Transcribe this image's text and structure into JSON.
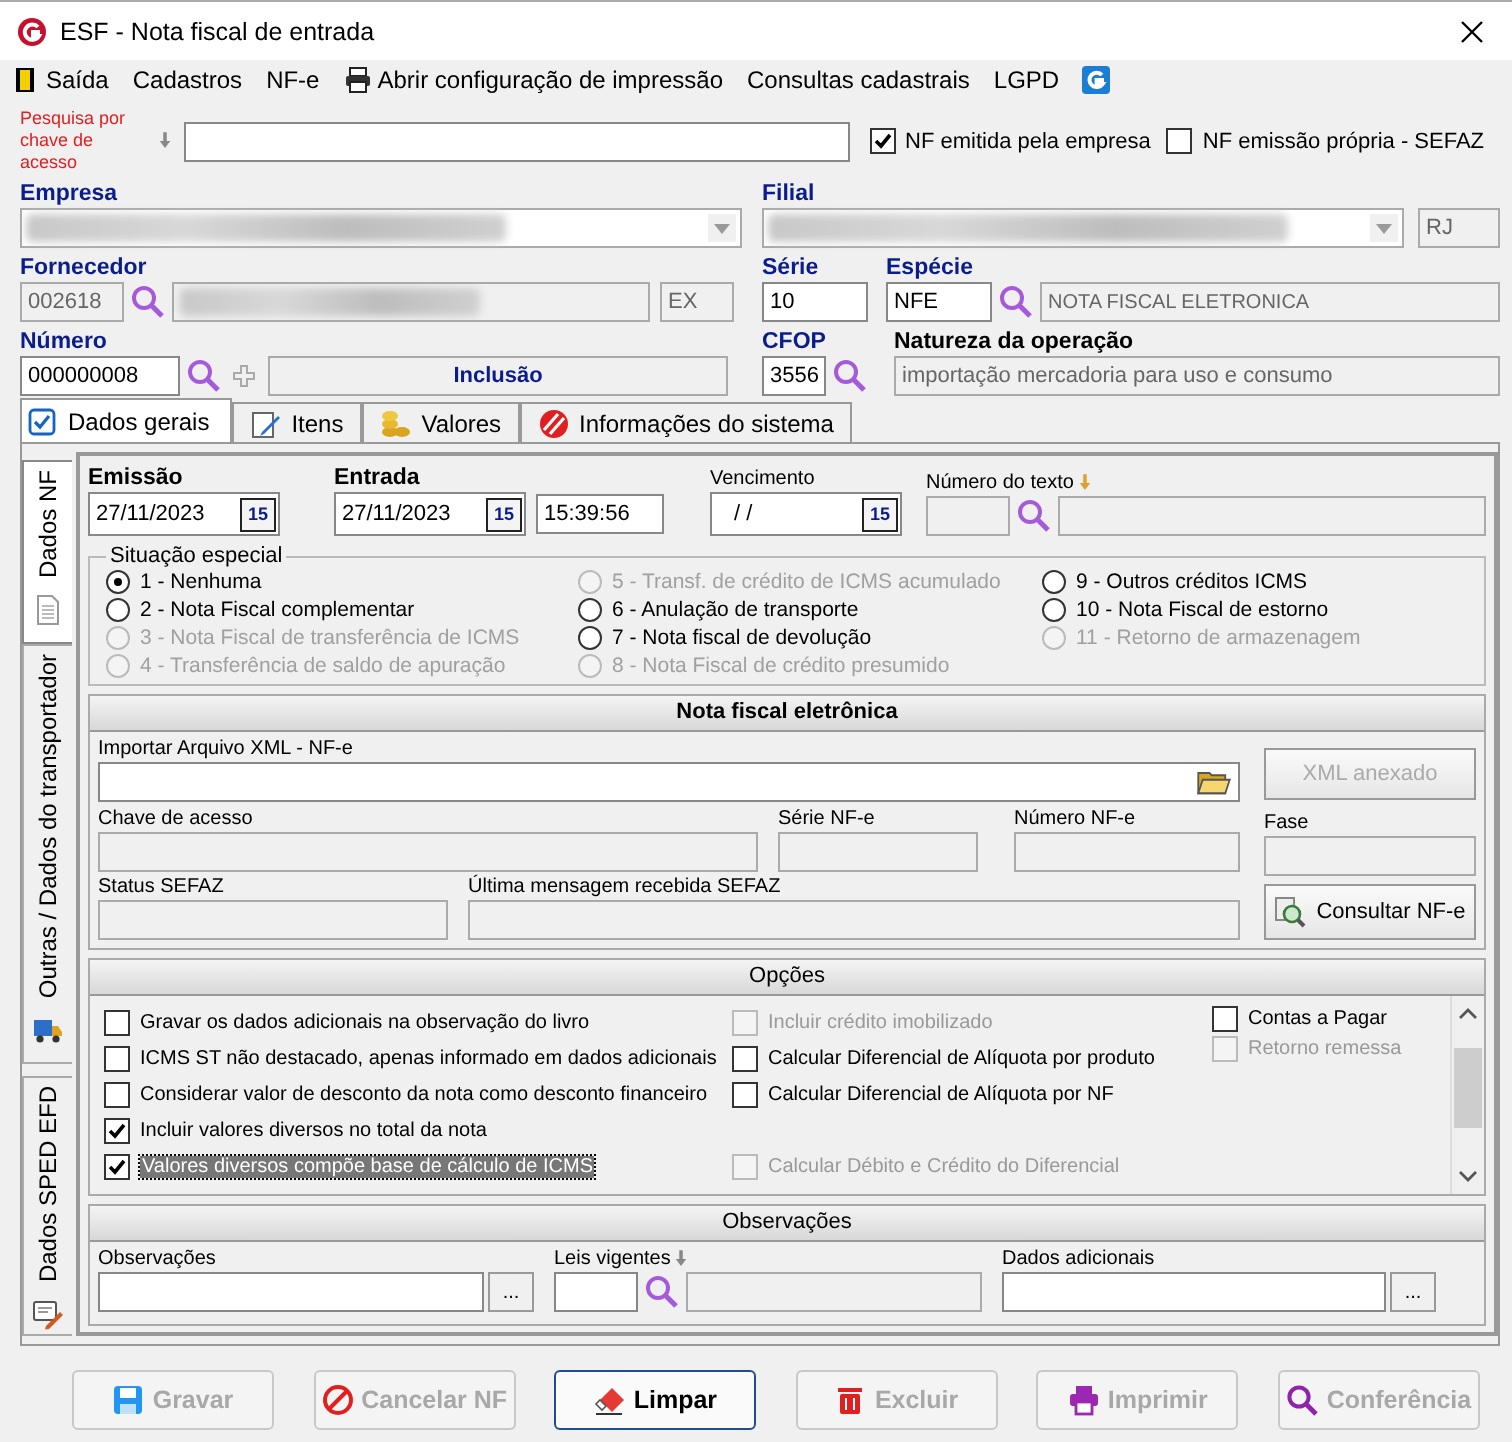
{
  "window": {
    "title": "ESF - Nota fiscal de entrada"
  },
  "menu": [
    {
      "label": "Saída"
    },
    {
      "label": "Cadastros"
    },
    {
      "label": "NF-e"
    },
    {
      "label": "Abrir configuração de impressão"
    },
    {
      "label": "Consultas cadastrais"
    },
    {
      "label": "LGPD"
    }
  ],
  "search": {
    "label": "Pesquisa por chave de acesso"
  },
  "flags": [
    {
      "label": "NF emitida pela empresa",
      "checked": true
    },
    {
      "label": "NF emissão própria - SEFAZ",
      "checked": false
    }
  ],
  "empresa": {
    "label": "Empresa"
  },
  "filial": {
    "label": "Filial",
    "uf": "RJ"
  },
  "fornecedor": {
    "label": "Fornecedor",
    "code": "002618",
    "uf": "EX"
  },
  "serie": {
    "label": "Série",
    "value": "10"
  },
  "especie": {
    "label": "Espécie",
    "code": "NFE",
    "name": "NOTA FISCAL ELETRONICA"
  },
  "numero": {
    "label": "Número",
    "value": "000000008",
    "mode": "Inclusão"
  },
  "cfop": {
    "label": "CFOP",
    "value": "3556"
  },
  "natureza": {
    "label": "Natureza da operação",
    "value": "importação mercadoria para uso e consumo"
  },
  "tabs": [
    {
      "label": "Dados gerais",
      "selected": true
    },
    {
      "label": "Itens",
      "selected": false
    },
    {
      "label": "Valores",
      "selected": false
    },
    {
      "label": "Informações do sistema",
      "selected": false
    }
  ],
  "side_tabs": [
    {
      "label": "Dados NF",
      "selected": true
    },
    {
      "label": "Outras / Dados do transportador",
      "selected": false
    },
    {
      "label": "Dados SPED EFD",
      "selected": false
    }
  ],
  "emissao": {
    "label": "Emissão",
    "value": "27/11/2023",
    "calendar": "15"
  },
  "entrada": {
    "label": "Entrada",
    "value": "27/11/2023",
    "calendar": "15",
    "time": "15:39:56"
  },
  "vencimento": {
    "label": "Vencimento",
    "value": "/ /",
    "calendar": "15"
  },
  "numero_texto": {
    "label": "Número do texto"
  },
  "situacao": {
    "title": "Situação especial",
    "options": [
      {
        "label": "1 - Nenhuma",
        "selected": true,
        "disabled": false
      },
      {
        "label": "2 - Nota Fiscal complementar",
        "selected": false,
        "disabled": false
      },
      {
        "label": "3 - Nota Fiscal de transferência de ICMS",
        "selected": false,
        "disabled": true
      },
      {
        "label": "4 - Transferência de saldo de apuração",
        "selected": false,
        "disabled": true
      },
      {
        "label": "5 - Transf. de crédito de ICMS acumulado",
        "selected": false,
        "disabled": true
      },
      {
        "label": "6 - Anulação de transporte",
        "selected": false,
        "disabled": false
      },
      {
        "label": "7 - Nota fiscal de devolução",
        "selected": false,
        "disabled": false
      },
      {
        "label": "8 - Nota Fiscal de crédito presumido",
        "selected": false,
        "disabled": true
      },
      {
        "label": "9 - Outros créditos ICMS",
        "selected": false,
        "disabled": false
      },
      {
        "label": "10 - Nota Fiscal de estorno",
        "selected": false,
        "disabled": false
      },
      {
        "label": "11 - Retorno de armazenagem",
        "selected": false,
        "disabled": true
      }
    ]
  },
  "nfe": {
    "title": "Nota fiscal eletrônica",
    "import_label": "Importar Arquivo XML - NF-e",
    "xml_button": {
      "label": "XML anexado",
      "disabled": true
    },
    "chave": "Chave de acesso",
    "serie": "Série NF-e",
    "numero": "Número NF-e",
    "fase": "Fase",
    "status": "Status SEFAZ",
    "mensagem": "Última mensagem recebida SEFAZ",
    "consult_button": "Consultar NF-e"
  },
  "opcoes": {
    "title": "Opções",
    "columns": [
      [
        {
          "kind": "checkbox",
          "label": "Gravar os dados adicionais na observação do livro",
          "checked": false,
          "disabled": false,
          "selected": false
        },
        {
          "kind": "checkbox",
          "label": "ICMS ST  não destacado, apenas informado em dados adicionais",
          "checked": false,
          "disabled": false,
          "selected": false
        },
        {
          "kind": "checkbox",
          "label": "Considerar valor de desconto da nota como desconto financeiro",
          "checked": false,
          "disabled": false,
          "selected": false
        },
        {
          "kind": "checkbox",
          "label": "Incluir valores diversos no total da nota",
          "checked": true,
          "disabled": false,
          "selected": false
        },
        {
          "kind": "checkbox",
          "label": "Valores diversos compõe base de cálculo de ICMS",
          "checked": true,
          "disabled": false,
          "selected": true
        }
      ],
      [
        {
          "kind": "checkbox",
          "label": "Incluir crédito imobilizado",
          "checked": false,
          "disabled": true,
          "selected": false
        },
        {
          "kind": "checkbox",
          "label": "Calcular Diferencial de Alíquota por produto",
          "checked": false,
          "disabled": false,
          "selected": false
        },
        {
          "kind": "checkbox",
          "label": "Calcular Diferencial de Alíquota por NF",
          "checked": false,
          "disabled": false,
          "selected": false
        },
        {
          "kind": "empty"
        },
        {
          "kind": "checkbox",
          "label": "Calcular Débito e Crédito do Diferencial",
          "checked": false,
          "disabled": true,
          "selected": false
        }
      ],
      [
        {
          "kind": "checkbox",
          "label": "Contas a Pagar",
          "checked": false,
          "disabled": false,
          "selected": false
        },
        {
          "kind": "checkbox",
          "label": "Retorno remessa",
          "checked": false,
          "disabled": true,
          "selected": false
        }
      ]
    ]
  },
  "observacoes": {
    "title": "Observações",
    "obs": {
      "label": "Observações",
      "button": "..."
    },
    "leis": {
      "label": "Leis vigentes"
    },
    "adicionais": {
      "label": "Dados adicionais",
      "button": "..."
    }
  },
  "buttons": [
    {
      "label": "Gravar",
      "disabled": true,
      "focused": false
    },
    {
      "label": "Cancelar NF",
      "disabled": true,
      "focused": false
    },
    {
      "label": "Limpar",
      "disabled": false,
      "focused": true
    },
    {
      "label": "Excluir",
      "disabled": true,
      "focused": false
    },
    {
      "label": "Imprimir",
      "disabled": true,
      "focused": false
    },
    {
      "label": "Conferência",
      "disabled": true,
      "focused": false
    }
  ]
}
